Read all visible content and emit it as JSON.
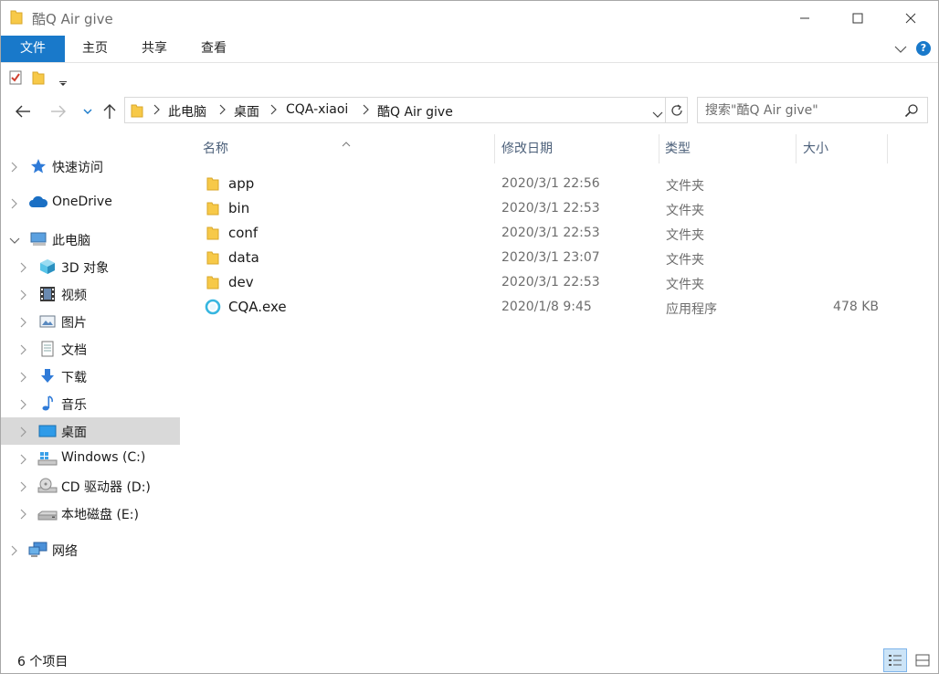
{
  "window": {
    "title": "酷Q Air give"
  },
  "ribbon": {
    "tabs": [
      "文件",
      "主页",
      "共享",
      "查看"
    ]
  },
  "address": {
    "crumbs": [
      "此电脑",
      "桌面",
      "CQA-xiaoi",
      "酷Q Air give"
    ]
  },
  "search": {
    "placeholder": "搜索\"酷Q Air give\""
  },
  "navpane": {
    "items": [
      {
        "label": "快速访问",
        "icon": "star-icon"
      },
      {
        "label": "OneDrive",
        "icon": "cloud-icon"
      },
      {
        "label": "此电脑",
        "icon": "computer-icon"
      },
      {
        "label": "3D 对象",
        "icon": "cube-icon"
      },
      {
        "label": "视频",
        "icon": "film-icon"
      },
      {
        "label": "图片",
        "icon": "picture-icon"
      },
      {
        "label": "文档",
        "icon": "document-icon"
      },
      {
        "label": "下载",
        "icon": "download-arrow-icon"
      },
      {
        "label": "音乐",
        "icon": "music-note-icon"
      },
      {
        "label": "桌面",
        "icon": "desktop-icon"
      },
      {
        "label": "Windows (C:)",
        "icon": "windows-drive-icon"
      },
      {
        "label": "CD 驱动器 (D:)",
        "icon": "cd-drive-icon"
      },
      {
        "label": "本地磁盘 (E:)",
        "icon": "hard-drive-icon"
      },
      {
        "label": "网络",
        "icon": "network-icon"
      }
    ],
    "selected": "桌面"
  },
  "columns": {
    "name": "名称",
    "date": "修改日期",
    "type": "类型",
    "size": "大小"
  },
  "files": [
    {
      "name": "app",
      "date": "2020/3/1 22:56",
      "type": "文件夹",
      "size": "",
      "icon": "folder-icon"
    },
    {
      "name": "bin",
      "date": "2020/3/1 22:53",
      "type": "文件夹",
      "size": "",
      "icon": "folder-icon"
    },
    {
      "name": "conf",
      "date": "2020/3/1 22:53",
      "type": "文件夹",
      "size": "",
      "icon": "folder-icon"
    },
    {
      "name": "data",
      "date": "2020/3/1 23:07",
      "type": "文件夹",
      "size": "",
      "icon": "folder-icon"
    },
    {
      "name": "dev",
      "date": "2020/3/1 22:53",
      "type": "文件夹",
      "size": "",
      "icon": "folder-icon"
    },
    {
      "name": "CQA.exe",
      "date": "2020/1/8 9:45",
      "type": "应用程序",
      "size": "478 KB",
      "icon": "cqa-app-icon"
    }
  ],
  "status": {
    "count": "6 个项目"
  },
  "colors": {
    "accent": "#1979ca",
    "selection": "#d9d9d9",
    "folder": "#f7c948"
  }
}
